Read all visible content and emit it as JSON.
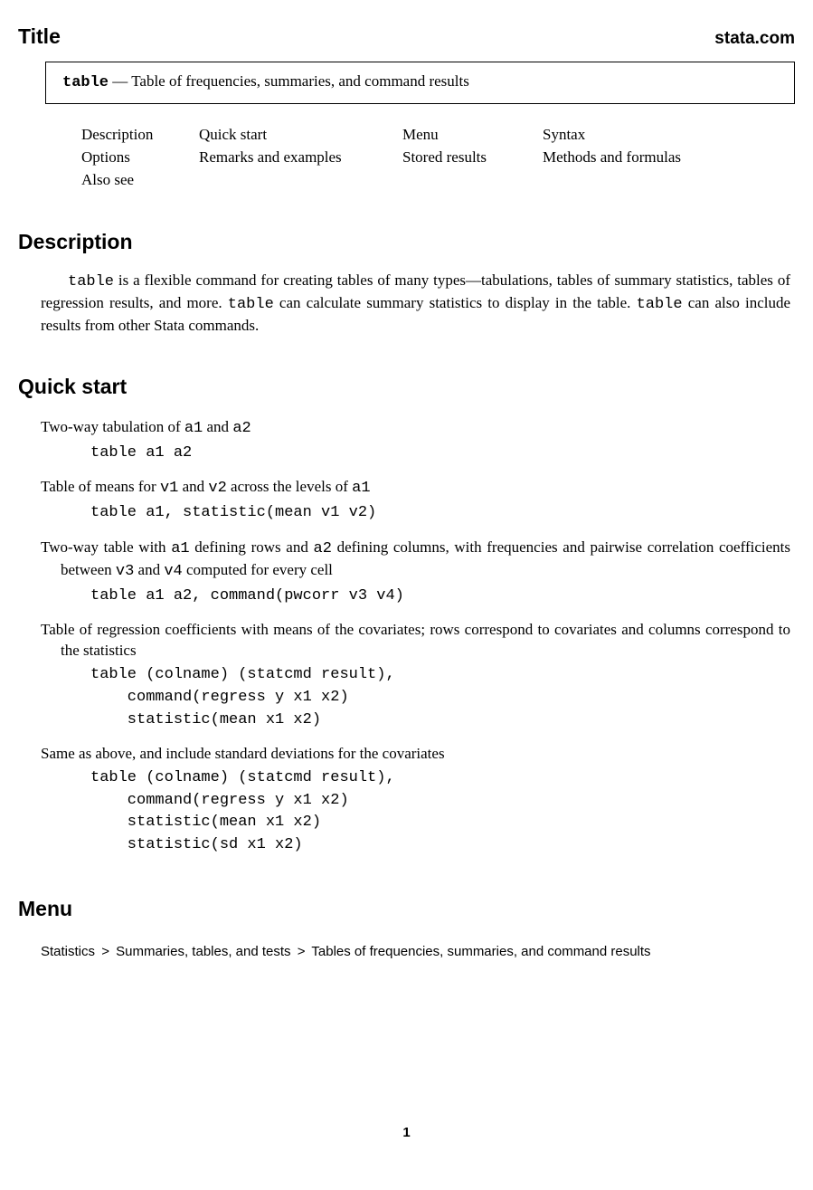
{
  "header": {
    "title": "Title",
    "brand": "stata.com"
  },
  "title_box": {
    "cmd": "table",
    "sep": " — ",
    "desc": "Table of frequencies, summaries, and command results"
  },
  "nav": {
    "r1c1": "Description",
    "r1c2": "Quick start",
    "r1c3": "Menu",
    "r1c4": "Syntax",
    "r2c1": "Options",
    "r2c2": "Remarks and examples",
    "r2c3": "Stored results",
    "r2c4": "Methods and formulas",
    "r3c1": "Also see"
  },
  "description": {
    "heading": "Description",
    "p1a": "table",
    "p1b": " is a flexible command for creating tables of many types—tabulations, tables of summary statistics, tables of regression results, and more. ",
    "p1c": "table",
    "p1d": " can calculate summary statistics to display in the table. ",
    "p1e": "table",
    "p1f": " can also include results from other Stata commands."
  },
  "quickstart": {
    "heading": "Quick start",
    "ex1": {
      "t1": "Two-way tabulation of ",
      "c1": "a1",
      "t2": " and ",
      "c2": "a2",
      "code": "table a1 a2"
    },
    "ex2": {
      "t1": "Table of means for ",
      "c1": "v1",
      "t2": " and ",
      "c2": "v2",
      "t3": " across the levels of ",
      "c3": "a1",
      "code": "table a1, statistic(mean v1 v2)"
    },
    "ex3": {
      "t1": "Two-way table with ",
      "c1": "a1",
      "t2": " defining rows and ",
      "c2": "a2",
      "t3": " defining columns, with frequencies and pairwise correlation coefficients between ",
      "c3": "v3",
      "t4": " and ",
      "c4": "v4",
      "t5": " computed for every cell",
      "code": "table a1 a2, command(pwcorr v3 v4)"
    },
    "ex4": {
      "t1": "Table of regression coefficients with means of the covariates; rows correspond to covariates and columns correspond to the statistics",
      "code": "table (colname) (statcmd result),\n    command(regress y x1 x2)\n    statistic(mean x1 x2)"
    },
    "ex5": {
      "t1": "Same as above, and include standard deviations for the covariates",
      "code": "table (colname) (statcmd result),\n    command(regress y x1 x2)\n    statistic(mean x1 x2)\n    statistic(sd x1 x2)"
    }
  },
  "menu": {
    "heading": "Menu",
    "p1": "Statistics",
    "gt": ">",
    "p2": "Summaries, tables, and tests",
    "p3": "Tables of frequencies, summaries, and command results"
  },
  "page": "1"
}
